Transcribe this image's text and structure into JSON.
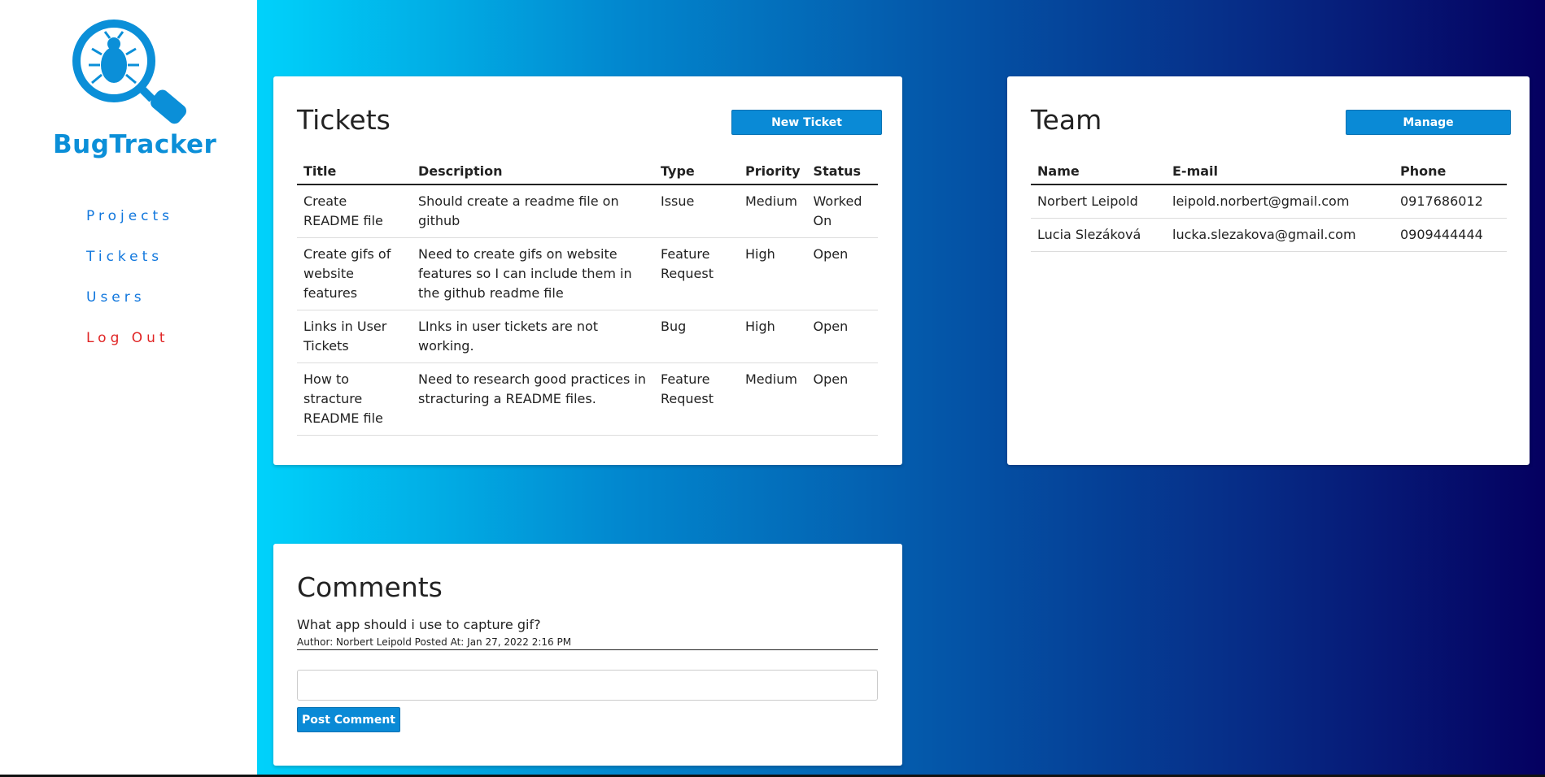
{
  "brand": {
    "name": "BugTracker",
    "color": "#0b8fd8"
  },
  "nav": {
    "items": [
      {
        "label": "Projects"
      },
      {
        "label": "Tickets"
      },
      {
        "label": "Users"
      },
      {
        "label": "Log Out"
      }
    ]
  },
  "tickets": {
    "title": "Tickets",
    "new_button": "New Ticket",
    "columns": [
      "Title",
      "Description",
      "Type",
      "Priority",
      "Status"
    ],
    "rows": [
      {
        "title": "Create README file",
        "description": "Should create a readme file on github",
        "type": "Issue",
        "priority": "Medium",
        "status": "Worked On"
      },
      {
        "title": "Create gifs of website features",
        "description": "Need to create gifs on website features so I can include them in the github readme file",
        "type": "Feature Request",
        "priority": "High",
        "status": "Open"
      },
      {
        "title": "Links in User Tickets",
        "description": "LInks in user tickets are not working.",
        "type": "Bug",
        "priority": "High",
        "status": "Open"
      },
      {
        "title": "How to stracture README file",
        "description": "Need to research good practices in stracturing a README files.",
        "type": "Feature Request",
        "priority": "Medium",
        "status": "Open"
      }
    ]
  },
  "team": {
    "title": "Team",
    "manage_button": "Manage",
    "columns": [
      "Name",
      "E-mail",
      "Phone"
    ],
    "rows": [
      {
        "name": "Norbert Leipold",
        "email": "leipold.norbert@gmail.com",
        "phone": "0917686012"
      },
      {
        "name": "Lucia Slezáková",
        "email": "lucka.slezakova@gmail.com",
        "phone": "0909444444"
      }
    ]
  },
  "comments": {
    "title": "Comments",
    "items": [
      {
        "text": "What app should i use to capture gif?",
        "meta": "Author: Norbert Leipold Posted At: Jan 27, 2022 2:16 PM"
      }
    ],
    "input_value": "",
    "post_button": "Post Comment"
  },
  "colors": {
    "accent": "#0a8ad6",
    "logout": "#e02525",
    "gradient_start": "#00d2fb",
    "gradient_end": "#050060"
  }
}
